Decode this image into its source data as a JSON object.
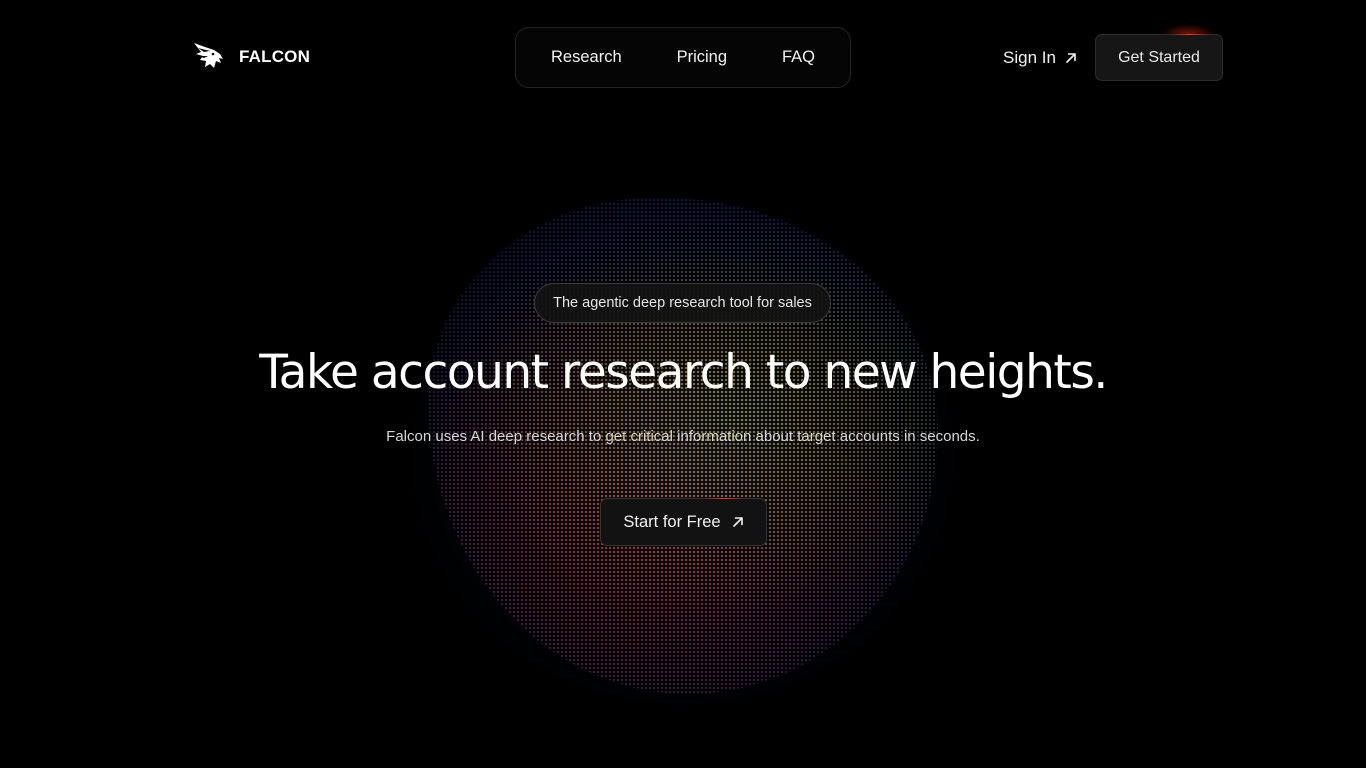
{
  "brand": {
    "name": "FALCON",
    "logo_icon": "falcon-head-icon"
  },
  "nav": {
    "links": [
      "Research",
      "Pricing",
      "FAQ"
    ]
  },
  "header": {
    "sign_in_label": "Sign In",
    "sign_in_icon": "arrow-up-right-icon",
    "get_started_label": "Get Started"
  },
  "hero": {
    "badge": "The agentic deep research tool for sales",
    "headline": "Take account research to new heights.",
    "subheadline": "Falcon uses AI deep research to get critical information about target accounts in seconds.",
    "cta_label": "Start for Free",
    "cta_icon": "arrow-up-right-icon"
  },
  "colors": {
    "background": "#000000",
    "text": "#ffffff",
    "accent_red": "#e62814",
    "orb_blue": "#142a78",
    "orb_orange": "#d72d05",
    "orb_yellow": "#a5af0a"
  }
}
